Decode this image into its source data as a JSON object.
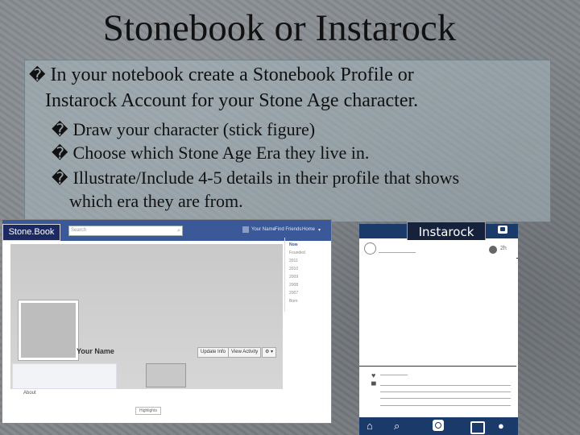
{
  "slide": {
    "title": "Stonebook or Instarock",
    "lines": [
      {
        "bullet": "�",
        "text": "In your notebook create a Stonebook Profile or"
      },
      {
        "bullet": "",
        "text": "Instarock Account for your Stone Age character."
      }
    ],
    "sub_bullets": [
      {
        "bullet": "�",
        "text": "Draw your character (stick figure)"
      },
      {
        "bullet": "�",
        "text": "Choose which Stone Age Era they live in."
      },
      {
        "bullet": "�",
        "text": "Illustrate/Include 4-5 details in their profile that shows"
      },
      {
        "bullet": "",
        "text": "which era they are from."
      }
    ]
  },
  "stonebook": {
    "label": "Stone.Book",
    "search_placeholder": "Search",
    "nav": [
      "Your Name",
      "Find Friends",
      "Home"
    ],
    "profile_name": "Your Name",
    "update_info": "Update Info",
    "view_activity": "View Activity",
    "about": "About",
    "highlights": "Highlights",
    "years": [
      "Now",
      "Founded",
      "2011",
      "2010",
      "2009",
      "2008",
      "2007",
      "Born"
    ]
  },
  "instarock": {
    "label": "Instarock",
    "time": "2h"
  }
}
